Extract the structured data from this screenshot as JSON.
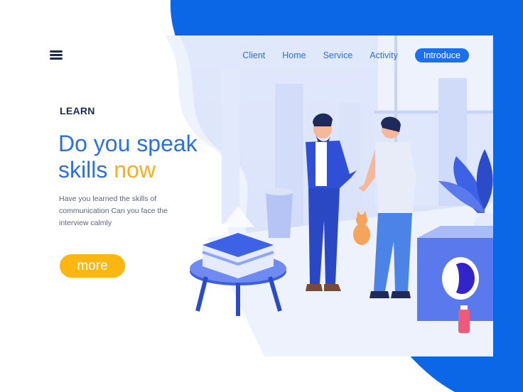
{
  "nav": {
    "items": [
      {
        "label": "Client",
        "active": false
      },
      {
        "label": "Home",
        "active": false
      },
      {
        "label": "Service",
        "active": false
      },
      {
        "label": "Activity",
        "active": false
      },
      {
        "label": "Introduce",
        "active": true
      }
    ]
  },
  "hero": {
    "eyebrow": "LEARN",
    "headline_line1": "Do you speak",
    "headline_line2_prefix": "skills ",
    "headline_accent": "now",
    "description": "Have you learned the skills of communication Can you face the interview calmly",
    "cta_label": "more"
  },
  "colors": {
    "brand_blue": "#0c67e6",
    "accent_yellow": "#fcb612",
    "text_dark": "#1e2a52",
    "link_blue": "#2b6fe0"
  },
  "icons": [
    "menu-icon"
  ]
}
